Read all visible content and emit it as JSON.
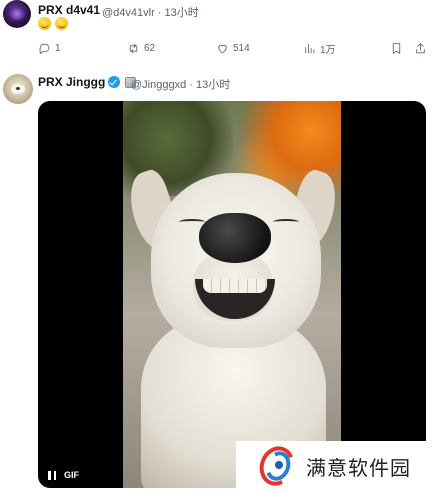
{
  "tweet1": {
    "display_name": "PRX d4v41",
    "handle_time": "@d4v41vlr · 13小时",
    "emojis": [
      "smiling-face-emoji",
      "smiling-face-emoji"
    ],
    "actions": {
      "reply_count": "1",
      "repost_count": "62",
      "like_count": "514",
      "views_count": "1万"
    }
  },
  "tweet2": {
    "display_name": "PRX Jinggg",
    "handle_time": "@Jingggxd · 13小时",
    "media": {
      "gif_label": "GIF"
    }
  },
  "watermark": {
    "text": "满意软件园"
  },
  "colors": {
    "text_primary": "#0f1419",
    "text_secondary": "#536471",
    "verified_blue": "#1d9bf0"
  }
}
